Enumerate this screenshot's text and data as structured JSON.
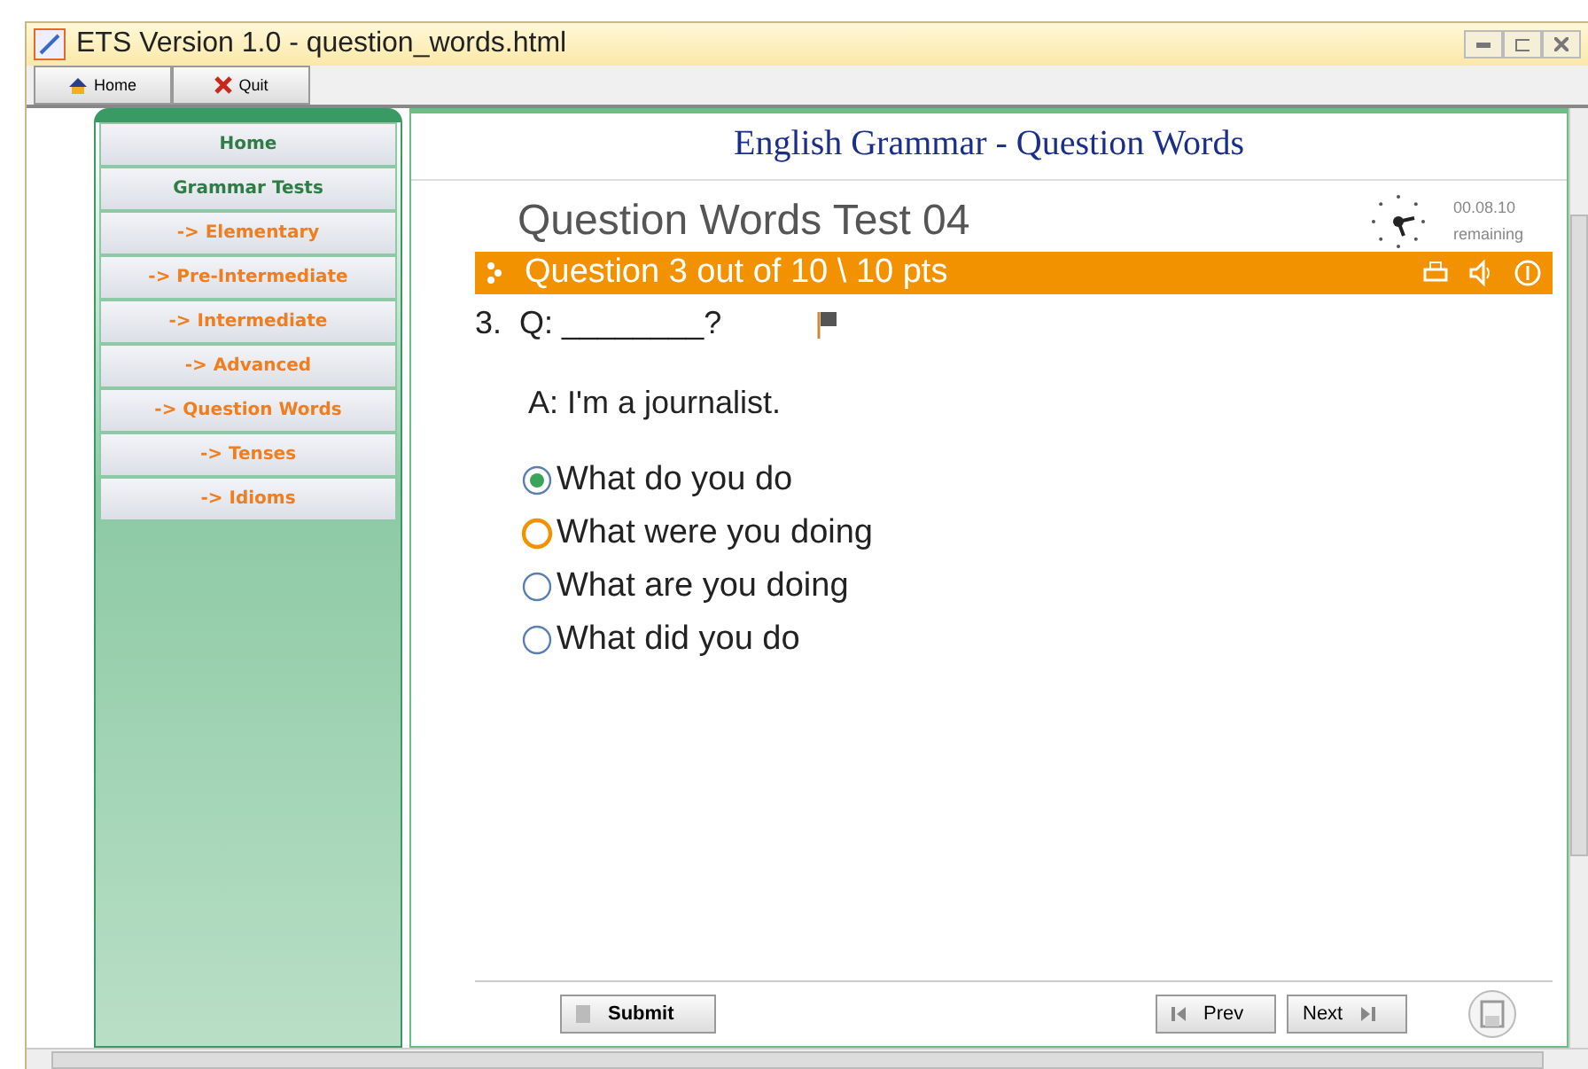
{
  "window": {
    "title": "ETS Version 1.0 - question_words.html"
  },
  "toolbar": [
    {
      "label": "Home",
      "kind": "home"
    },
    {
      "label": "Quit",
      "kind": "quit"
    }
  ],
  "sidebar": {
    "items": [
      {
        "label": "Home",
        "kind": "section"
      },
      {
        "label": "Grammar Tests",
        "kind": "section"
      },
      {
        "label": "-> Elementary",
        "kind": "link"
      },
      {
        "label": "-> Pre-Intermediate",
        "kind": "link"
      },
      {
        "label": "-> Intermediate",
        "kind": "link"
      },
      {
        "label": "-> Advanced",
        "kind": "link"
      },
      {
        "label": "-> Question Words",
        "kind": "link"
      },
      {
        "label": "-> Tenses",
        "kind": "link"
      },
      {
        "label": "-> Idioms",
        "kind": "link"
      }
    ]
  },
  "page": {
    "heading": "English Grammar - Question Words",
    "test_title": "Question Words Test 04",
    "timer": "00.08.10",
    "timer_label": "remaining",
    "question_bar": "Question 3 out of 10 \\ 10 pts",
    "number": "3.",
    "question": "Q: ________?",
    "answer": "A: I'm a journalist.",
    "options": [
      {
        "label": "What do you do",
        "selected": true,
        "focused": false
      },
      {
        "label": "What were you doing",
        "selected": false,
        "focused": true
      },
      {
        "label": "What are you doing",
        "selected": false,
        "focused": false
      },
      {
        "label": "What did you do",
        "selected": false,
        "focused": false
      }
    ],
    "submit": "Submit",
    "prev": "Prev",
    "next": "Next"
  }
}
